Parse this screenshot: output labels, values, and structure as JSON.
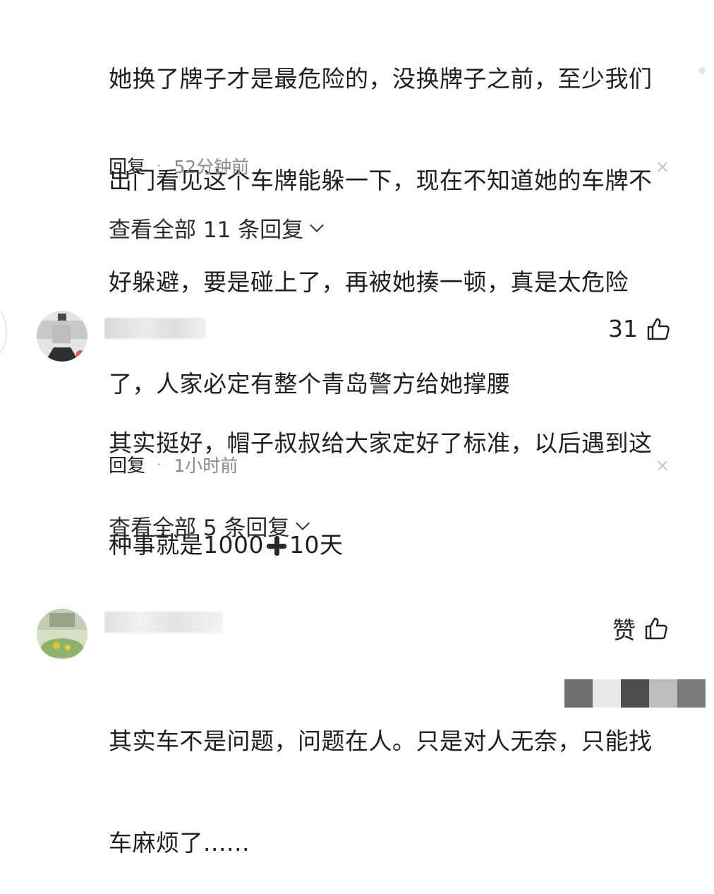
{
  "comment1": {
    "lines": [
      "她换了牌子才是最危险的，没换牌子之前，至少我们",
      "出门看见这个车牌能躲一下，现在不知道她的车牌不",
      "好躲避，要是碰上了，再被她揍一顿，真是太危险",
      "了，人家必定有整个青岛警方给她撑腰"
    ],
    "reply_label": "回复",
    "time": "52分钟前",
    "close_icon": "×",
    "view_replies": "查看全部 11 条回复"
  },
  "comment2": {
    "likes": "31",
    "line1": "其实挺好，帽子叔叔给大家定好了标准，以后遇到这",
    "line2_a": "种事就是1000",
    "line2_b": "10天",
    "reply_label": "回复",
    "time": "1小时前",
    "close_icon": "×",
    "view_replies": "查看全部 5 条回复"
  },
  "comment3": {
    "likes": "赞",
    "line1": "其实车不是问题，问题在人。只是对人无奈，只能找",
    "line2": "车麻烦了......"
  },
  "colors": {
    "text": "#1f1f1f",
    "meta_gray": "#8a8a8a"
  }
}
